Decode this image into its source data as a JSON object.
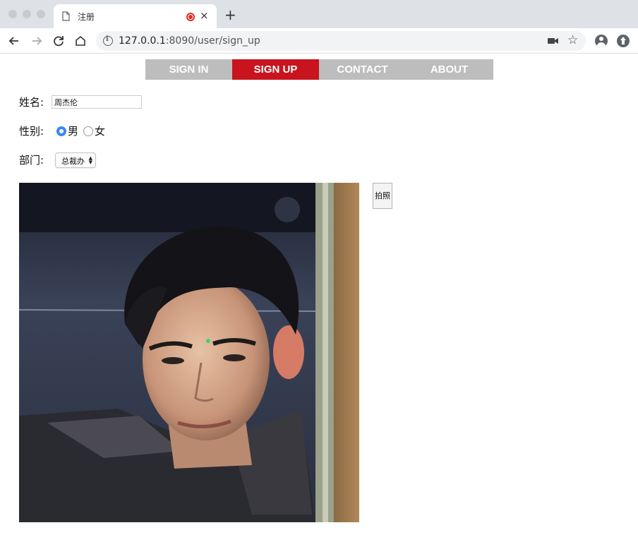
{
  "browser": {
    "tab_title": "注册",
    "tab_close": "×",
    "new_tab": "+",
    "url_host": "127.0.0.1",
    "url_rest": ":8090/user/sign_up"
  },
  "nav": {
    "items": [
      {
        "label": "SIGN IN",
        "active": false
      },
      {
        "label": "SIGN UP",
        "active": true
      },
      {
        "label": "CONTACT",
        "active": false
      },
      {
        "label": "ABOUT",
        "active": false
      }
    ],
    "accent": "#c8141e",
    "background": "#bdbdbd"
  },
  "form": {
    "name_label": "姓名:",
    "name_value": "周杰伦",
    "gender_label": "性别:",
    "gender_options": [
      "男",
      "女"
    ],
    "gender_selected": "男",
    "department_label": "部门:",
    "department_value": "总裁办"
  },
  "camera": {
    "capture_button": "拍照"
  }
}
